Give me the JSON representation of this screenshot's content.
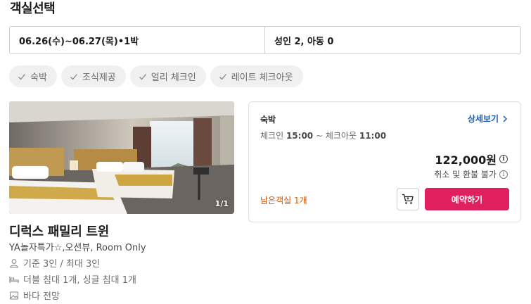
{
  "section": {
    "title": "객실선택"
  },
  "search": {
    "dates": "06.26(수)~06.27(목)•1박",
    "guests": "성인 2, 아동 0"
  },
  "filters": [
    {
      "label": "숙박",
      "icon": "check-icon"
    },
    {
      "label": "조식제공",
      "icon": "check-icon"
    },
    {
      "label": "얼리 체크인",
      "icon": "check-icon"
    },
    {
      "label": "레이트 체크아웃",
      "icon": "check-icon"
    }
  ],
  "room": {
    "photo_counter": "1/1",
    "name": "디럭스 패밀리 트윈",
    "description": "YA놀자특가☆,오션뷰, Room Only",
    "capacity": "기준 3인 / 최대 3인",
    "beds": "더블 침대 1개, 싱글 침대 1개",
    "view": "바다 전망"
  },
  "rate": {
    "type": "숙박",
    "detail_link": "상세보기",
    "checkin_label": "체크인",
    "checkin_time": "15:00",
    "separator": " ~ ",
    "checkout_label": "체크아웃",
    "checkout_time": "11:00",
    "price": "122,000원",
    "refund_policy": "취소 및 환불 불가",
    "remaining": "남은객실 1개",
    "reserve_label": "예약하기"
  },
  "colors": {
    "accent": "#e01f5e",
    "link": "#1a5fb4",
    "warning": "#d35400"
  }
}
